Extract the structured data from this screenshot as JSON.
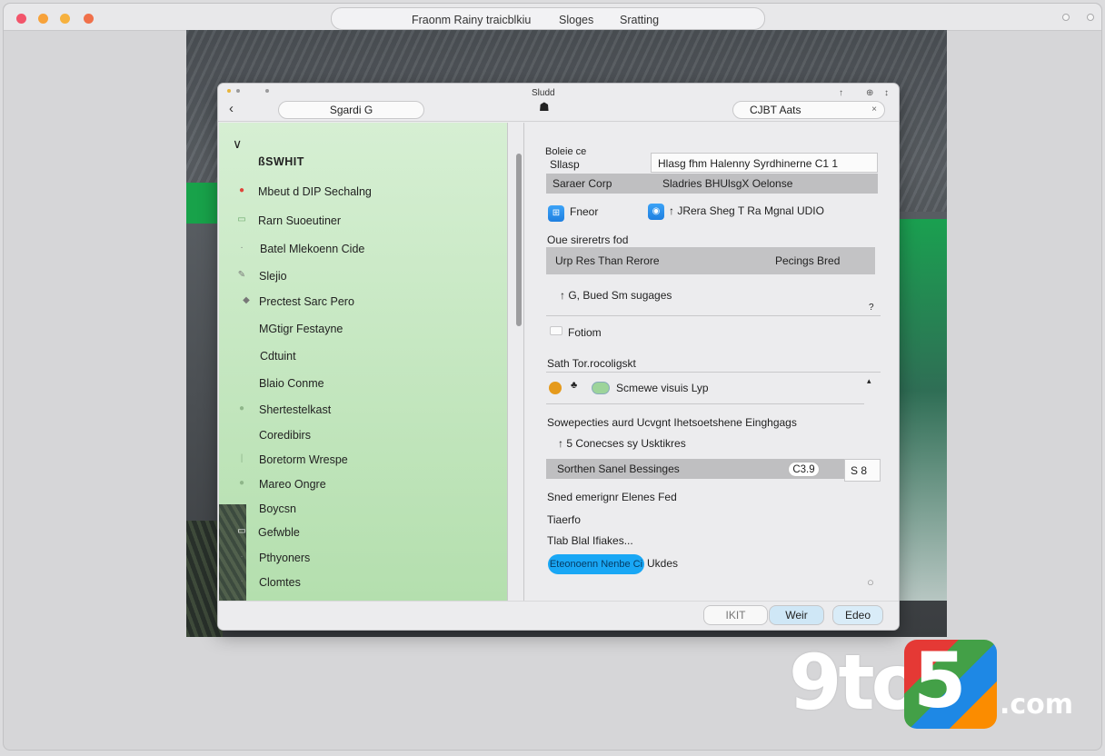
{
  "outer_window": {
    "title_parts": [
      "Fraonm Rainy traicblkiu",
      "Sloges",
      "Sratting"
    ],
    "traffic_light_colors": [
      "#f2556b",
      "#f7a23a",
      "#f6b13e",
      "#f0704a"
    ]
  },
  "window": {
    "title": "Sludd",
    "search_label": "Sgardi G",
    "right_field_label": "CJBT  Aats",
    "top_icons": [
      "↑",
      "⊕",
      "↕"
    ]
  },
  "sidebar": {
    "header": "ßSWHIT",
    "items": [
      {
        "label": "Mbeut d DIP Sechalng",
        "icon": "●"
      },
      {
        "label": "Rarn Suoeutiner",
        "icon": "▭"
      },
      {
        "label": "Batel Mlekoenn Cide",
        "icon": "·"
      },
      {
        "label": "Slejio",
        "icon": "✎"
      },
      {
        "label": "Prectest Sarc Pero",
        "icon": "◆"
      },
      {
        "label": "MGtigr Festayne",
        "icon": ""
      },
      {
        "label": "Cdtuint",
        "icon": ""
      },
      {
        "label": "Blaio Conme",
        "icon": ""
      },
      {
        "label": "Shertestelkast",
        "icon": "●"
      },
      {
        "label": "Coredibirs",
        "icon": ""
      },
      {
        "label": "Boretorm Wrespe",
        "icon": "|"
      },
      {
        "label": "Mareo Ongre",
        "icon": "●"
      },
      {
        "label": "Boycsn",
        "icon": ""
      },
      {
        "label": "Gefwble",
        "icon": "▭"
      },
      {
        "label": "Pthyoners",
        "icon": "·"
      },
      {
        "label": "Clomtes",
        "icon": "·"
      }
    ]
  },
  "main": {
    "section1_title": "Boleie ce",
    "section1_sub": "Sllasp",
    "header_box_text": "Hlasg fhm   Halenny Syrdhinerne C1 1",
    "gray_row1_left": "Saraer Corp",
    "gray_row1_right": "Sladries   BHUlsgX Oelonse",
    "item_a_label": "Fneor",
    "item_b_label": "↑ JRera Sheg    T Ra Mgnal UDIO",
    "section2_title": "Oue sireretrs fod",
    "gray_row2_left": "Urp Res Than Rerore",
    "gray_row2_right": "Pecings Bred",
    "sub_row": "↑ G, Bued Sm sugages",
    "mark1": "?",
    "checkbox_label": "Fotiom",
    "section3_title": "Sath Tor.rocoligskt",
    "item_c_label": "Scmewe visuis Lyp",
    "mark2": "▴",
    "section4_title": "Sowepecties  aurd Ucvgnt Ihetsoetshene Einghgags",
    "sub_row2": "↑ 5 Conecses sy Usktikres",
    "gray_row3_left": "Sorthen Sanel Bessinges",
    "pill_value": "C3.9",
    "box_value": "S 8",
    "line1": "Sned emerignr Elenes Fed",
    "line2": "Tiaerfo",
    "line3": "Tlab Blal Ifiakes...",
    "blue_button": "Eteonoenn Nenbe Ci",
    "blue_button_suffix": "Ukdes",
    "help_icon": "○"
  },
  "footer": {
    "btn1": "IKIT",
    "btn2": "Weir",
    "btn3": "Edeo"
  },
  "logo": {
    "prefix": "9to",
    "badge": "5",
    "suffix": ".com"
  }
}
